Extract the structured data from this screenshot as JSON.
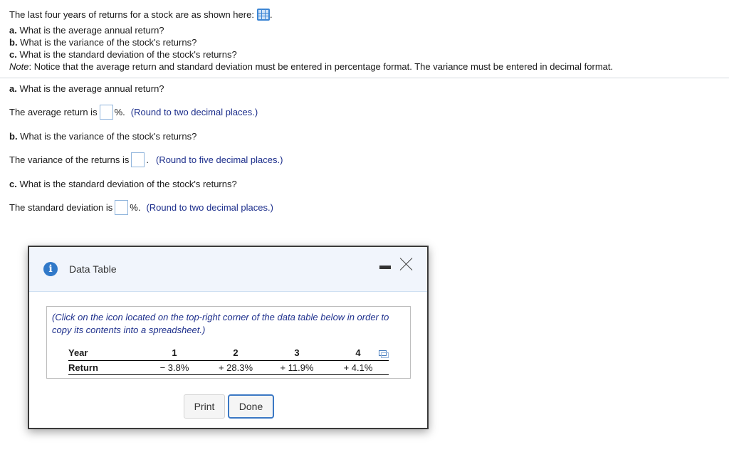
{
  "question": {
    "intro": "The last four years of returns for a stock are as shown here:",
    "intro_suffix": ".",
    "icon": "data-table-icon",
    "parts": [
      {
        "letter": "a.",
        "text": " What is the average annual return?"
      },
      {
        "letter": "b.",
        "text": " What is the variance of the stock's returns?"
      },
      {
        "letter": "c.",
        "text": " What is the standard deviation of the stock's returns?"
      }
    ],
    "note_label": "Note",
    "note_text": ": Notice that the average return and standard deviation must be entered in percentage format. The variance must be entered in decimal format."
  },
  "answers": {
    "a": {
      "question_letter": "a.",
      "question_text": " What is the average annual return?",
      "prefix": "The average return is",
      "suffix": "%.",
      "value": "",
      "hint": "(Round to two decimal places.)"
    },
    "b": {
      "question_letter": "b.",
      "question_text": " What is the variance of the stock's returns?",
      "prefix": "The variance of the returns is",
      "suffix": ".",
      "value": "",
      "hint": "(Round to five decimal places.)"
    },
    "c": {
      "question_letter": "c.",
      "question_text": " What is the standard deviation of the stock's returns?",
      "prefix": "The standard deviation is",
      "suffix": "%.",
      "value": "",
      "hint": "(Round to two decimal places.)"
    }
  },
  "modal": {
    "title": "Data Table",
    "info_icon": "i",
    "instruction": "(Click on the icon located on the top-right corner of the data table below in order to copy its contents into a spreadsheet.)",
    "table": {
      "header_label": "Year",
      "years": [
        "1",
        "2",
        "3",
        "4"
      ],
      "row_label": "Return",
      "returns": [
        "− 3.8%",
        "+ 28.3%",
        "+ 11.9%",
        "+ 4.1%"
      ]
    },
    "buttons": {
      "print": "Print",
      "done": "Done"
    }
  }
}
